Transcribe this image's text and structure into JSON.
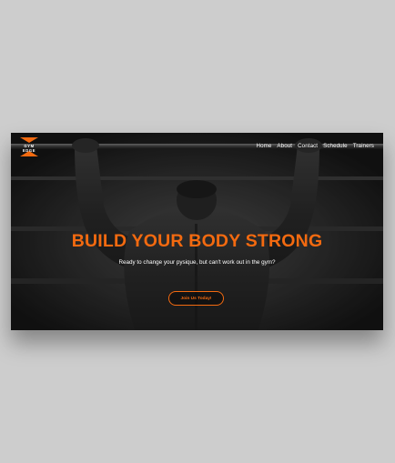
{
  "brand": {
    "line1": "GYM",
    "line2": "EDGE",
    "accent": "#f36a10"
  },
  "nav": {
    "items": [
      {
        "label": "Home"
      },
      {
        "label": "About"
      },
      {
        "label": "Contact"
      },
      {
        "label": "Schedule"
      },
      {
        "label": "Trainers"
      }
    ]
  },
  "hero": {
    "title": "BUILD YOUR BODY STRONG",
    "subtitle": "Ready to change your pysique, but can't work out in the gym?",
    "cta_label": "Join Us Today!"
  }
}
